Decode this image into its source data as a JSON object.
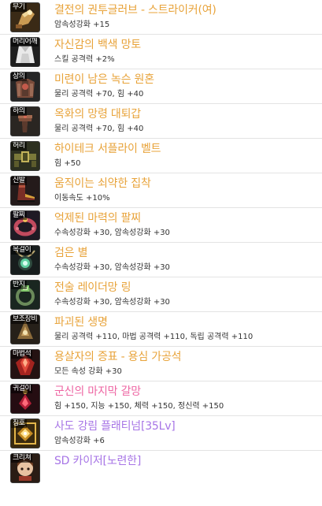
{
  "colors": {
    "unique": "#e8a33a",
    "legendary": "#ee66a3",
    "epic": "#a775e6",
    "text": "#333333",
    "divider": "#e3e3e3"
  },
  "items": [
    {
      "slot": "무기",
      "name": "결전의 권투글러브 - 스트라이커(여)",
      "stat": "암속성강화 +15",
      "grade": "unique",
      "icon": "glove-weapon-icon"
    },
    {
      "slot": "머리어깨",
      "name": "자신감의 백색 망토",
      "stat": "스킬 공격력 +2%",
      "grade": "unique",
      "icon": "cape-icon"
    },
    {
      "slot": "상의",
      "name": "미련이 남은 녹슨 원혼",
      "stat": "물리 공격력 +70, 힘 +40",
      "grade": "unique",
      "icon": "chest-armor-icon"
    },
    {
      "slot": "하의",
      "name": "옥화의 망령 대퇴갑",
      "stat": "물리 공격력 +70, 힘 +40",
      "grade": "unique",
      "icon": "leg-armor-icon"
    },
    {
      "slot": "허리",
      "name": "하이테크 서플라이 벨트",
      "stat": "힘 +50",
      "grade": "unique",
      "icon": "belt-icon"
    },
    {
      "slot": "신발",
      "name": "움직이는 쇠약한 집착",
      "stat": "이동속도 +10%",
      "grade": "unique",
      "icon": "shoes-icon"
    },
    {
      "slot": "팔찌",
      "name": "억제된 마력의 팔찌",
      "stat": "수속성강화 +30, 암속성강화 +30",
      "grade": "unique",
      "icon": "bracelet-icon"
    },
    {
      "slot": "목걸이",
      "name": "검은 별",
      "stat": "수속성강화 +30, 암속성강화 +30",
      "grade": "unique",
      "icon": "necklace-icon"
    },
    {
      "slot": "반지",
      "name": "전술 레이더망 링",
      "stat": "수속성강화 +30, 암속성강화 +30",
      "grade": "unique",
      "icon": "ring-icon"
    },
    {
      "slot": "보조장비",
      "name": "파괴된 생명",
      "stat": "물리 공격력 +110, 마법 공격력 +110, 독립 공격력 +110",
      "grade": "unique",
      "icon": "sub-equipment-icon"
    },
    {
      "slot": "마법석",
      "name": "용살자의 증표 - 용심 가공석",
      "stat": "모든 속성 강화 +30",
      "grade": "unique",
      "icon": "magic-stone-icon"
    },
    {
      "slot": "귀걸이",
      "name": "군신의 마지막 갈망",
      "stat": "힘 +150, 지능 +150, 체력 +150, 정신력 +150",
      "grade": "legendary",
      "icon": "earring-icon"
    },
    {
      "slot": "칭호",
      "name": "사도 강림 플래티넘[35Lv]",
      "stat": "암속성강화 +6",
      "grade": "epic",
      "icon": "title-emblem-icon"
    },
    {
      "slot": "크리쳐",
      "name": "SD 카이저[노련한]",
      "stat": "",
      "grade": "epic",
      "icon": "creature-icon"
    }
  ]
}
